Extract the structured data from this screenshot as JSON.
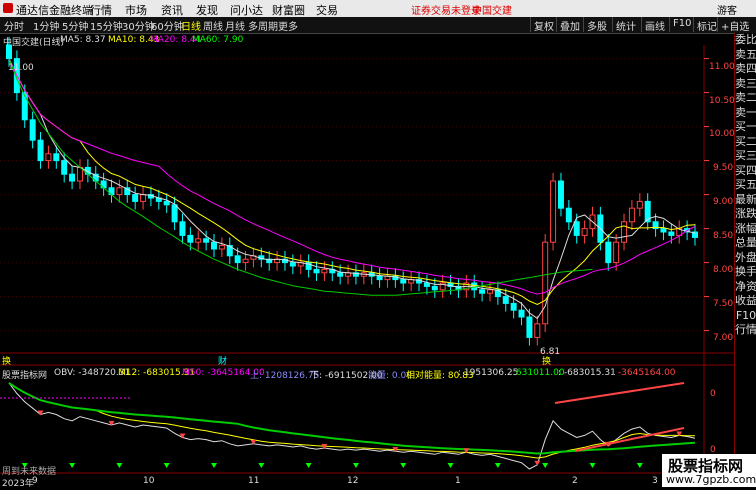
{
  "titlebar": {
    "app_title": "通达信金融终端",
    "menus": [
      "行情",
      "市场",
      "资讯",
      "发现",
      "问小达",
      "财富圈",
      "交易"
    ],
    "notice": "证券交易未登录",
    "stock": "中国交建",
    "guest": "游客"
  },
  "toolbar": {
    "periods": [
      "分时",
      "1分钟",
      "5分钟",
      "15分钟",
      "30分钟",
      "60分钟",
      "日线",
      "周线",
      "月线",
      "多周期",
      "更多"
    ],
    "active": "日线",
    "right": [
      "复权",
      "叠加",
      "多股",
      "统计",
      "画线",
      "F10",
      "标记",
      "+自选"
    ]
  },
  "main_chart": {
    "header": "中国交建(日线)",
    "ma5": "MA5: 8.37",
    "ma10": "MA10: 8.43",
    "ma20": "MA20: 8.44",
    "ma60": "MA60: 7.90",
    "high_label": "11.00",
    "low_label": "6.81",
    "markers": [
      "换",
      "财",
      "换"
    ]
  },
  "axis": {
    "prices": [
      "11.00",
      "10.50",
      "10.00",
      "9.50",
      "9.00",
      "8.50",
      "8.00",
      "7.50",
      "7.00"
    ],
    "indicator_ticks": [
      "0",
      "0"
    ],
    "dates": [
      "2023年",
      "9",
      "10",
      "11",
      "12",
      "1",
      "2",
      "3"
    ]
  },
  "indicator": {
    "name": "股票指标网",
    "obv": "OBV: -348720.31",
    "m12": "M12: -683015.31",
    "m50": "M50: -3645164.00",
    "up_label": "上: 1208126.75",
    "down_label": "下: -6911502.00",
    "nengliang": "能量: 0.00",
    "xiangdui": "相对能量: 80.83",
    "v1": ": 1951306.25",
    "v2": ": 631011.00",
    "v3": ": -683015.31",
    "v4": ": -3645164.00",
    "footer": "周到未来数据"
  },
  "sidebar": [
    "委比",
    "卖五",
    "卖四",
    "卖三",
    "卖二",
    "卖一",
    "买一",
    "买二",
    "买三",
    "买四",
    "买五",
    "最新",
    "涨跌",
    "涨幅",
    "总量",
    "外盘",
    "换手",
    "净资",
    "收益",
    "F10",
    "行情"
  ],
  "watermark": {
    "line1": "股票指标网",
    "line2": "www.7gpzb.com"
  },
  "chart_data": {
    "type": "line",
    "title": "中国交建(日线)",
    "ylim": [
      6.7,
      11.2
    ],
    "price_ticks": [
      11.0,
      10.5,
      10.0,
      9.5,
      9.0,
      8.5,
      8.0,
      7.5,
      7.0
    ],
    "close": [
      11.0,
      10.5,
      10.1,
      9.8,
      9.5,
      9.6,
      9.5,
      9.3,
      9.2,
      9.4,
      9.3,
      9.2,
      9.1,
      9.0,
      9.1,
      9.0,
      8.9,
      9.0,
      8.95,
      8.9,
      8.85,
      8.6,
      8.4,
      8.3,
      8.35,
      8.3,
      8.2,
      8.25,
      8.1,
      8.0,
      8.05,
      8.1,
      8.05,
      8.0,
      8.05,
      8.0,
      7.95,
      8.0,
      7.9,
      7.85,
      7.9,
      7.85,
      7.8,
      7.85,
      7.8,
      7.85,
      7.8,
      7.75,
      7.8,
      7.75,
      7.7,
      7.75,
      7.7,
      7.65,
      7.6,
      7.7,
      7.65,
      7.6,
      7.7,
      7.6,
      7.55,
      7.6,
      7.5,
      7.4,
      7.3,
      7.2,
      6.9,
      7.1,
      8.3,
      9.2,
      8.8,
      8.6,
      8.4,
      8.5,
      8.7,
      8.3,
      8.0,
      8.3,
      8.6,
      8.8,
      8.9,
      8.6,
      8.5,
      8.45,
      8.4,
      8.5,
      8.45,
      8.37
    ],
    "ma60": [
      11.0,
      10.7,
      10.45,
      10.25,
      10.05,
      9.9,
      9.75,
      9.6,
      9.5,
      9.4,
      9.3,
      9.2,
      9.1,
      9.0,
      8.9,
      8.82,
      8.75,
      8.68,
      8.6,
      8.52,
      8.45,
      8.38,
      8.3,
      8.23,
      8.17,
      8.11,
      8.05,
      8.0,
      7.95,
      7.9,
      7.86,
      7.82,
      7.78,
      7.75,
      7.72,
      7.69,
      7.66,
      7.64,
      7.62,
      7.6,
      7.58,
      7.57,
      7.56,
      7.55,
      7.54,
      7.53,
      7.52,
      7.52,
      7.52,
      7.52,
      7.53,
      7.54,
      7.55,
      7.56,
      7.57,
      7.58,
      7.59,
      7.6,
      7.62,
      7.64,
      7.66,
      7.68,
      7.7,
      7.72,
      7.74,
      7.76,
      7.78,
      7.8,
      7.82,
      7.84,
      7.86,
      7.87,
      7.88,
      7.89,
      7.9
    ]
  }
}
